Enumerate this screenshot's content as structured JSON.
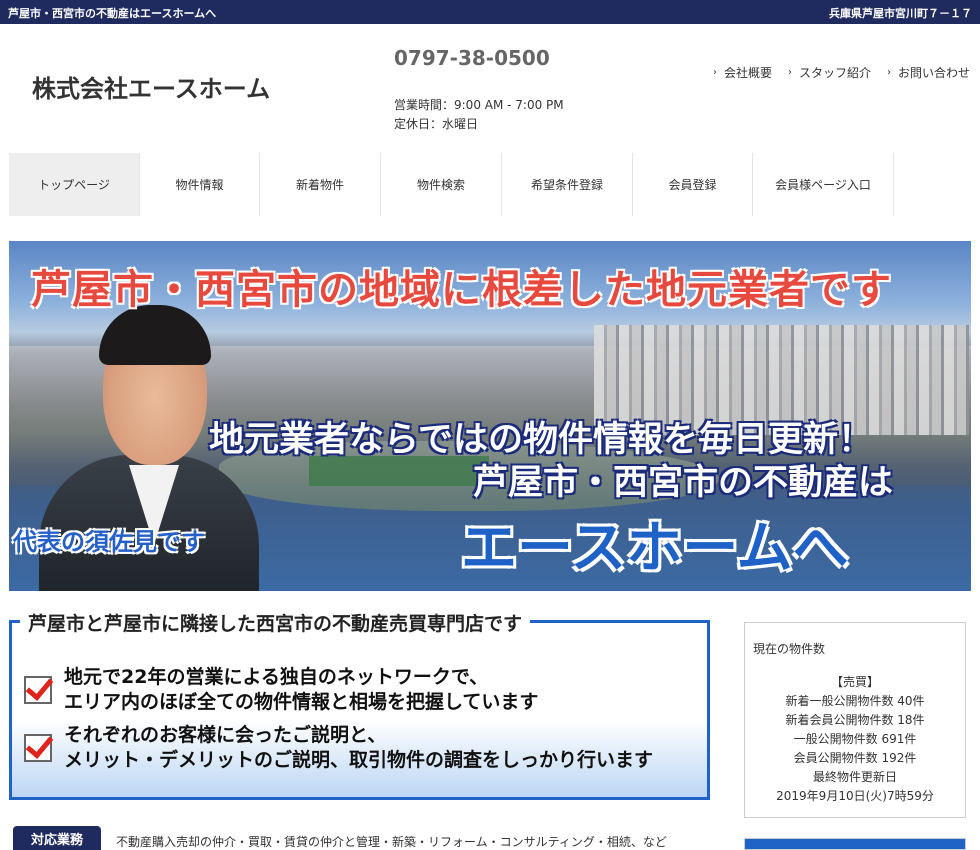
{
  "topbar": {
    "left": "芦屋市・西宮市の不動産はエースホームへ",
    "right": "兵庫県芦屋市宮川町７－１７"
  },
  "header": {
    "company": "株式会社エースホーム",
    "phone": "0797-38-0500",
    "hours": "営業時間：9:00 AM - 7:00 PM",
    "holiday": "定休日：水曜日",
    "links": [
      "会社概要",
      "スタッフ紹介",
      "お問い合わせ"
    ]
  },
  "nav": {
    "items": [
      "トップページ",
      "物件情報",
      "新着物件",
      "物件検索",
      "希望条件登録",
      "会員登録",
      "会員様ページ入口"
    ]
  },
  "banner": {
    "headline": "芦屋市・西宮市の地域に根差した地元業者です",
    "sub1": "地元業者ならではの物件情報を毎日更新！",
    "sub2": "芦屋市・西宮市の不動産は",
    "brand": "エースホームへ",
    "representative": "代表の須佐見です"
  },
  "feature": {
    "title": "芦屋市と芦屋市に隣接した西宮市の不動産売買専門店です",
    "points": [
      {
        "line1": "地元で22年の営業による独自のネットワークで、",
        "line2": "エリア内のほぼ全ての物件情報と相場を把握しています"
      },
      {
        "line1": "それぞれのお客様に会ったご説明と、",
        "line2": "メリット・デメリットのご説明、取引物件の調査をしっかり行います"
      }
    ]
  },
  "stats": {
    "title": "現在の物件数",
    "lines": [
      "【売買】",
      "新着一般公開物件数 40件",
      "新着会員公開物件数 18件",
      "一般公開物件数 691件",
      "会員公開物件数 192件",
      "最終物件更新日",
      "2019年9月10日(火)7時59分"
    ]
  },
  "services": {
    "label": "対応業務",
    "text": "不動産購入売却の仲介・買取・賃貸の仲介と管理・新築・リフォーム・コンサルティング・相続、など"
  },
  "colors": {
    "navy": "#1f2a5f",
    "accent_blue": "#1f63c7",
    "headline_red": "#e8493e",
    "check_red": "#e0241b"
  }
}
